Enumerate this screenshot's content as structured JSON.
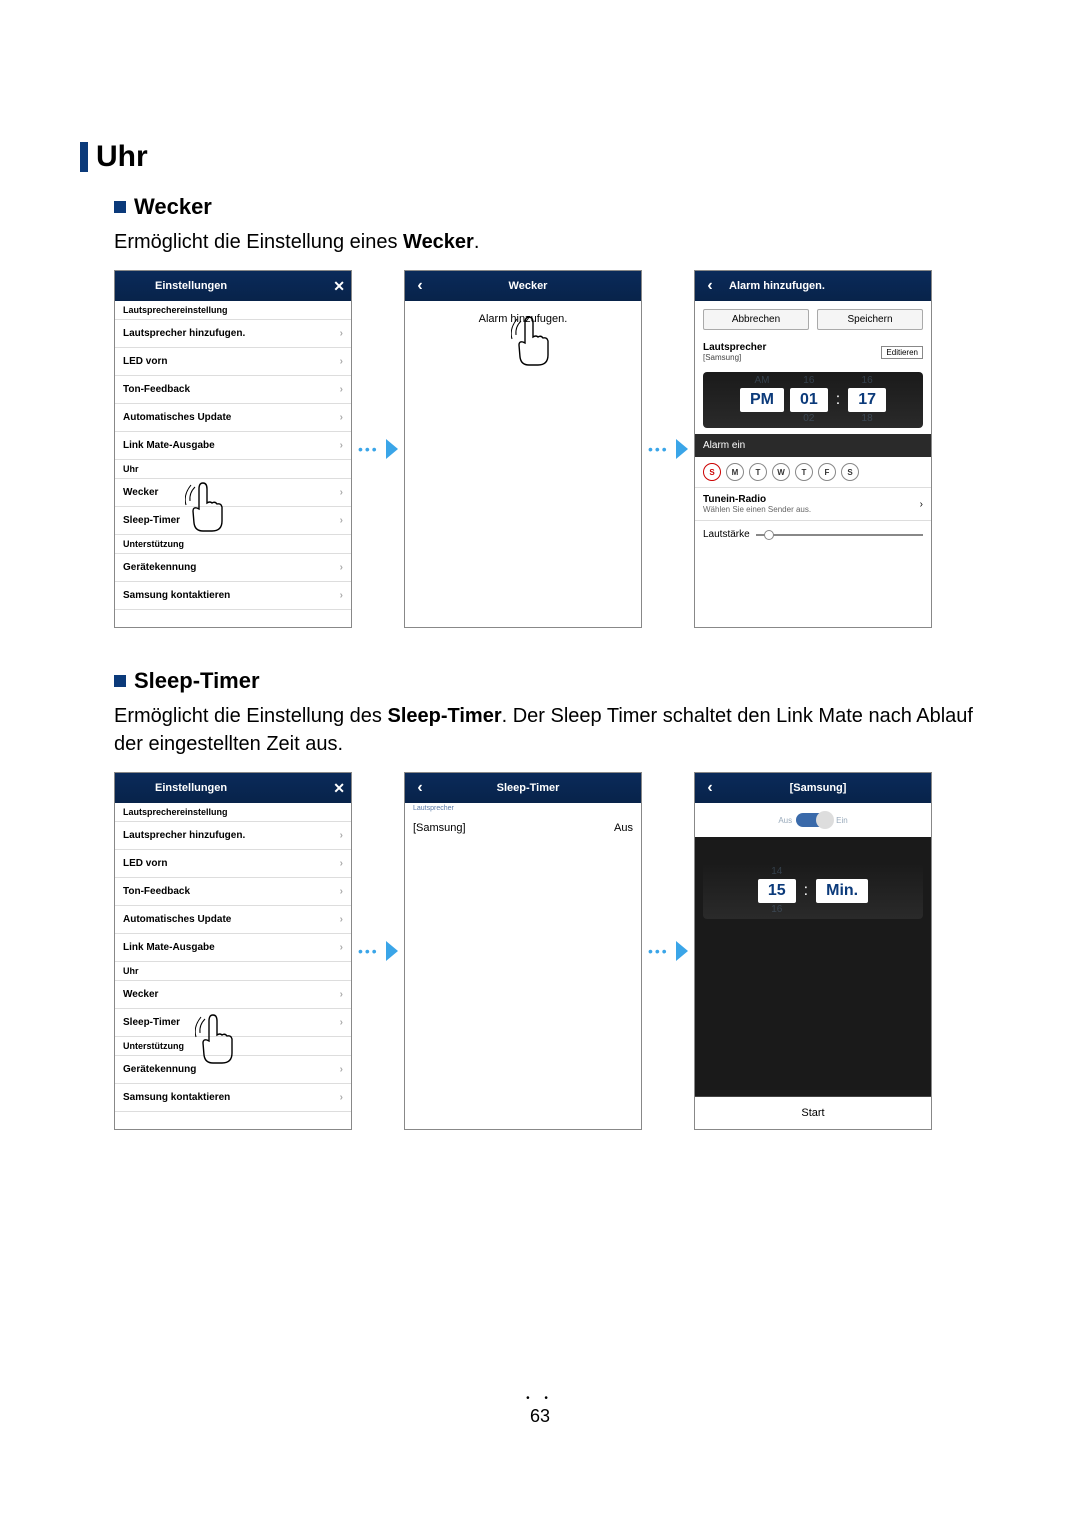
{
  "section": {
    "h1": "Uhr"
  },
  "wecker": {
    "h2": "Wecker",
    "desc_pre": "Ermöglicht die Einstellung eines ",
    "desc_bold": "Wecker",
    "desc_post": "."
  },
  "sleep": {
    "h2": "Sleep-Timer",
    "desc_pre": "Ermöglicht die Einstellung des ",
    "desc_bold": "Sleep-Timer",
    "desc_post": ". Der Sleep Timer schaltet den Link Mate nach Ablauf der eingestellten Zeit aus."
  },
  "settings_screen": {
    "title": "Einstellungen",
    "close": "✕",
    "sect1": "Lautsprechereinstellung",
    "items1": [
      "Lautsprecher hinzufugen.",
      "LED vorn",
      "Ton-Feedback",
      "Automatisches Update",
      "Link Mate-Ausgabe"
    ],
    "sect2": "Uhr",
    "items2": [
      "Wecker",
      "Sleep-Timer"
    ],
    "sect3": "Unterstützung",
    "items3": [
      "Gerätekennung",
      "Samsung kontaktieren"
    ]
  },
  "wecker_screen": {
    "title": "Wecker",
    "add": "Alarm hinzufugen."
  },
  "add_alarm_screen": {
    "title": "Alarm hinzufugen.",
    "cancel": "Abbrechen",
    "save": "Speichern",
    "speaker_label": "Lautsprecher",
    "speaker_name": "[Samsung]",
    "edit": "Editieren",
    "am": "AM",
    "pm": "PM",
    "hour_up": "16",
    "hour_sel": "01",
    "hour_dn": "02",
    "min_up": "16",
    "min_sel": "17",
    "min_dn": "18",
    "colon": ":",
    "alarm_on": "Alarm ein",
    "days": [
      "S",
      "M",
      "T",
      "W",
      "T",
      "F",
      "S"
    ],
    "radio_label": "Tunein-Radio",
    "radio_sub": "Wählen Sie einen Sender aus.",
    "vol_label": "Lautstärke"
  },
  "sleep_timer_screen": {
    "title": "Sleep-Timer",
    "sect": "Lautsprecher",
    "speaker": "[Samsung]",
    "state": "Aus"
  },
  "samsung_screen": {
    "title": "[Samsung]",
    "tog_off": "Aus",
    "tog_on": "Ein",
    "val_up": "14",
    "val_sel": "15",
    "val_dn": "16",
    "unit": "Min.",
    "start": "Start"
  },
  "page_number": "63"
}
